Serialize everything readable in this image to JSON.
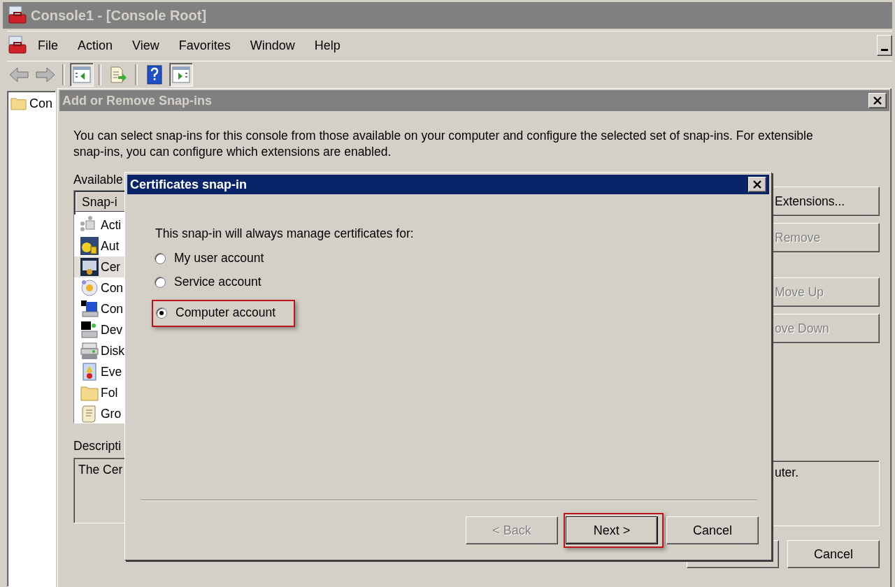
{
  "window": {
    "title": "Console1 - [Console Root]"
  },
  "menu_bar": {
    "items": [
      "File",
      "Action",
      "View",
      "Favorites",
      "Window",
      "Help"
    ]
  },
  "toolbar": {
    "buttons": [
      {
        "kind": "back",
        "pressed": false
      },
      {
        "kind": "forward",
        "pressed": false
      },
      {
        "kind": "tree",
        "pressed": true
      },
      {
        "kind": "export",
        "pressed": false
      },
      {
        "kind": "help",
        "pressed": false
      },
      {
        "kind": "pane",
        "pressed": true
      }
    ]
  },
  "tree": {
    "items": [
      "Con"
    ]
  },
  "add_remove_dialog": {
    "title": "Add or Remove Snap-ins",
    "intro": "You can select snap-ins for this console from those available on your computer and configure the selected set of snap-ins. For extensible snap-ins, you can configure which extensions are enabled.",
    "available_label": "Available",
    "snap_in_list": {
      "column": "Snap-i",
      "items": [
        {
          "label": "Acti",
          "selected": false
        },
        {
          "label": "Aut",
          "selected": false
        },
        {
          "label": "Cer",
          "selected": true
        },
        {
          "label": "Con",
          "selected": false
        },
        {
          "label": "Con",
          "selected": false
        },
        {
          "label": "Dev",
          "selected": false
        },
        {
          "label": "Disk",
          "selected": false
        },
        {
          "label": "Eve",
          "selected": false
        },
        {
          "label": "Fol",
          "selected": false
        },
        {
          "label": "Gro",
          "selected": false
        }
      ]
    },
    "description_label": "Descripti",
    "description_start": "The Cer",
    "description_end": "uter.",
    "side_buttons": [
      {
        "label": "Extensions...",
        "disabled": false
      },
      {
        "label": "Remove",
        "disabled": true
      },
      {
        "label": "Move Up",
        "disabled": true
      },
      {
        "label": "ove Down",
        "disabled": true
      }
    ],
    "cancel_button": "Cancel"
  },
  "certificates_dialog": {
    "title": "Certificates snap-in",
    "prompt": "This snap-in will always manage certificates for:",
    "options": [
      {
        "label": "My user account",
        "selected": false,
        "highlighted": false
      },
      {
        "label": "Service account",
        "selected": false,
        "highlighted": false
      },
      {
        "label": "Computer account",
        "selected": true,
        "highlighted": true
      }
    ],
    "buttons": [
      {
        "label": "< Back",
        "disabled": true,
        "highlighted": false
      },
      {
        "label": "Next >",
        "disabled": false,
        "highlighted": true
      },
      {
        "label": "Cancel",
        "disabled": false,
        "highlighted": false
      }
    ]
  }
}
